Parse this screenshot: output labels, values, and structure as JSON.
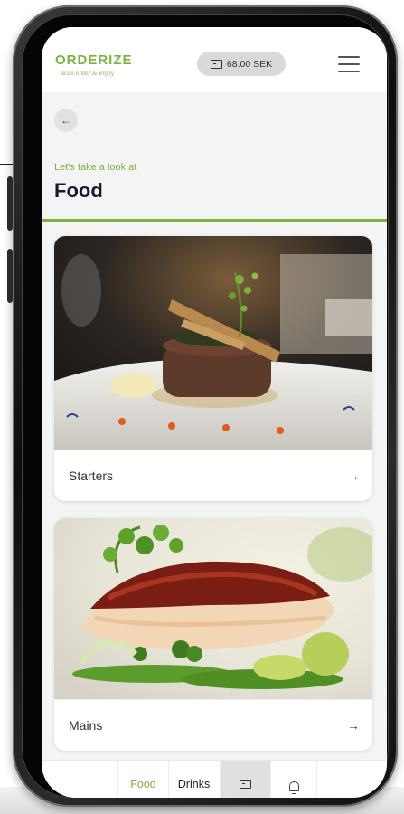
{
  "header": {
    "logo": "ORDERIZE",
    "tagline": "scan order & enjoy",
    "balance": "68.00 SEK"
  },
  "page": {
    "eyebrow": "Let's take a look at",
    "title": "Food"
  },
  "categories": [
    {
      "label": "Starters",
      "arrow": "→"
    },
    {
      "label": "Mains",
      "arrow": "→"
    }
  ],
  "nav": {
    "food": "Food",
    "drinks": "Drinks"
  },
  "colors": {
    "accent": "#7bb342",
    "title": "#1a1a2e"
  },
  "icons": {
    "back": "arrow-left-icon",
    "menu": "hamburger-icon",
    "wallet": "wallet-card-icon",
    "bell": "bell-icon"
  }
}
